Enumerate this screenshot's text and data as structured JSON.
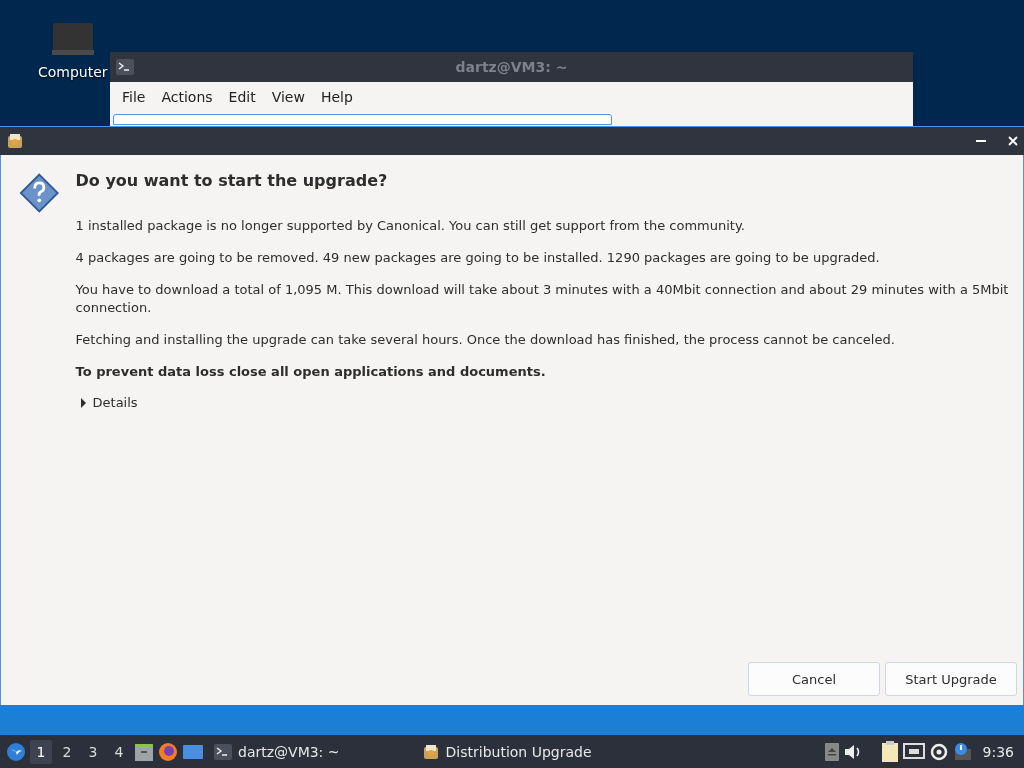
{
  "desktop": {
    "icons": [
      {
        "label": "Computer"
      }
    ]
  },
  "terminal_window": {
    "title": "dartz@VM3: ~",
    "menu": [
      "File",
      "Actions",
      "Edit",
      "View",
      "Help"
    ]
  },
  "dialog": {
    "heading": "Do you want to start the upgrade?",
    "paragraphs": [
      {
        "text": "1 installed package is no longer supported by Canonical. You can still get support from the community.",
        "bold": false
      },
      {
        "text": "4 packages are going to be removed. 49 new packages are going to be installed. 1290 packages are going to be upgraded.",
        "bold": false
      },
      {
        "text": "You have to download a total of 1,095 M. This download will take about 3 minutes with a 40Mbit connection and about 29 minutes with a 5Mbit connection.",
        "bold": false
      },
      {
        "text": "Fetching and installing the upgrade can take several hours. Once the download has finished, the process cannot be canceled.",
        "bold": false
      },
      {
        "text": "To prevent data loss close all open applications and documents.",
        "bold": true
      }
    ],
    "details": {
      "label": "Details",
      "expanded": false
    },
    "buttons": [
      "Cancel",
      "Start Upgrade"
    ]
  },
  "taskbar": {
    "workspaces": [
      {
        "label": "1",
        "selected": true
      },
      {
        "label": "2",
        "selected": false
      },
      {
        "label": "3",
        "selected": false
      },
      {
        "label": "4",
        "selected": false
      }
    ],
    "tasks": [
      {
        "label": "dartz@VM3: ~",
        "kind": "terminal"
      },
      {
        "label": "Distribution Upgrade",
        "kind": "upgrade"
      }
    ],
    "clock": "9:36"
  }
}
